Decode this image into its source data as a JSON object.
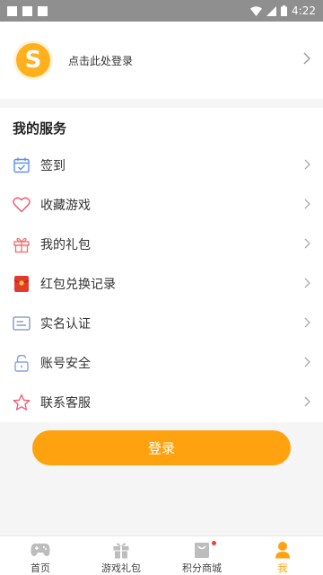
{
  "status_bar": {
    "time": "4:22"
  },
  "profile": {
    "avatar_letter": "S",
    "login_hint": "点击此处登录"
  },
  "services": {
    "title": "我的服务",
    "items": [
      {
        "label": "签到",
        "icon": "calendar-check-icon"
      },
      {
        "label": "收藏游戏",
        "icon": "heart-icon"
      },
      {
        "label": "我的礼包",
        "icon": "gift-icon"
      },
      {
        "label": "红包兑换记录",
        "icon": "red-envelope-icon"
      },
      {
        "label": "实名认证",
        "icon": "id-card-icon"
      },
      {
        "label": "账号安全",
        "icon": "lock-icon"
      },
      {
        "label": "联系客服",
        "icon": "star-icon"
      }
    ]
  },
  "login_button": {
    "label": "登录"
  },
  "tabbar": {
    "tabs": [
      {
        "label": "首页",
        "icon": "gamepad-icon"
      },
      {
        "label": "游戏礼包",
        "icon": "gift-icon"
      },
      {
        "label": "积分商城",
        "icon": "shopping-bag-icon"
      },
      {
        "label": "我",
        "icon": "person-icon",
        "active": true
      }
    ]
  },
  "colors": {
    "accent": "#ffa20f",
    "status_bar": "#8f8f8f"
  }
}
